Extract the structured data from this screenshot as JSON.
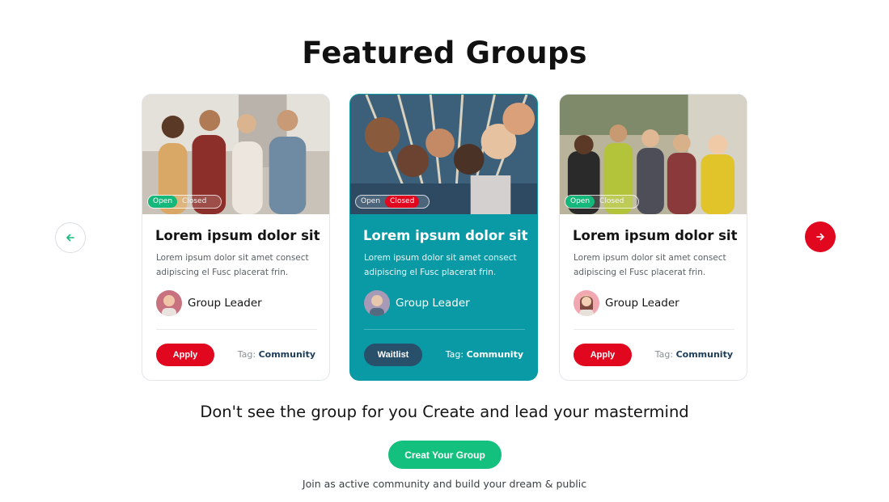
{
  "section": {
    "title": "Featured Groups"
  },
  "carousel": {
    "prev_icon": "arrow-left-icon",
    "next_icon": "arrow-right-icon",
    "colors": {
      "accent_red": "#e0071f",
      "teal": "#0a9aa6",
      "green": "#14b87a"
    }
  },
  "cards": [
    {
      "status_open": "Open",
      "status_closed": "Closed",
      "status_active": "Open",
      "title": "Lorem ipsum dolor sit",
      "description": "Lorem ipsum dolor sit amet consect adipiscing el Fusc placerat frin.",
      "leader": "Group Leader",
      "action": "Apply",
      "tag_label": "Tag:",
      "tag_value": "Community"
    },
    {
      "status_open": "Open",
      "status_closed": "Closed",
      "status_active": "Closed",
      "title": "Lorem ipsum dolor sit",
      "description": "Lorem ipsum dolor sit amet consect adipiscing el Fusc placerat frin.",
      "leader": "Group Leader",
      "action": "Waitlist",
      "tag_label": "Tag:",
      "tag_value": "Community"
    },
    {
      "status_open": "Open",
      "status_closed": "Closed",
      "status_active": "Open",
      "title": "Lorem ipsum dolor sit",
      "description": "Lorem ipsum dolor sit amet consect adipiscing el Fusc placerat frin.",
      "leader": "Group Leader",
      "action": "Apply",
      "tag_label": "Tag:",
      "tag_value": "Community"
    }
  ],
  "cta": {
    "heading": "Don't see the group for you Create and lead your mastermind",
    "button": "Creat Your Group",
    "subtext": "Join as active community and build your dream & public"
  }
}
